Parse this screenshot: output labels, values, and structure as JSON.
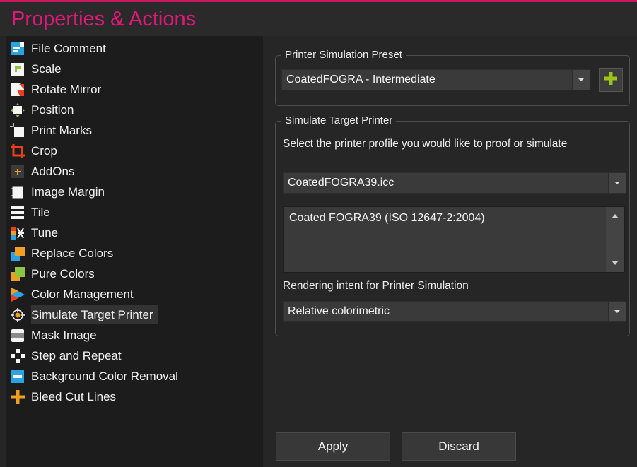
{
  "header": {
    "title": "Properties & Actions",
    "accent_color": "#e3177a"
  },
  "sidebar": {
    "items": [
      {
        "label": "File Comment",
        "icon": "file-comment-icon"
      },
      {
        "label": "Scale",
        "icon": "scale-icon"
      },
      {
        "label": "Rotate Mirror",
        "icon": "rotate-mirror-icon"
      },
      {
        "label": "Position",
        "icon": "position-icon"
      },
      {
        "label": "Print Marks",
        "icon": "print-marks-icon"
      },
      {
        "label": "Crop",
        "icon": "crop-icon"
      },
      {
        "label": "AddOns",
        "icon": "addons-icon"
      },
      {
        "label": "Image Margin",
        "icon": "image-margin-icon"
      },
      {
        "label": "Tile",
        "icon": "tile-icon"
      },
      {
        "label": "Tune",
        "icon": "tune-icon"
      },
      {
        "label": "Replace Colors",
        "icon": "replace-colors-icon"
      },
      {
        "label": "Pure Colors",
        "icon": "pure-colors-icon"
      },
      {
        "label": "Color Management",
        "icon": "color-management-icon"
      },
      {
        "label": "Simulate Target Printer",
        "icon": "simulate-target-printer-icon",
        "selected": true
      },
      {
        "label": "Mask Image",
        "icon": "mask-image-icon"
      },
      {
        "label": "Step and Repeat",
        "icon": "step-and-repeat-icon"
      },
      {
        "label": "Background Color Removal",
        "icon": "background-color-removal-icon"
      },
      {
        "label": "Bleed Cut Lines",
        "icon": "bleed-cut-lines-icon"
      }
    ]
  },
  "preset_group": {
    "legend": "Printer Simulation Preset",
    "selected": "CoatedFOGRA - Intermediate",
    "add_icon": "plus-icon"
  },
  "simulate_group": {
    "legend": "Simulate Target Printer",
    "instruction": "Select the printer profile you would like to proof or simulate",
    "profile_selected": "CoatedFOGRA39.icc",
    "profile_description": "Coated FOGRA39 (ISO 12647-2:2004)",
    "intent_label": "Rendering intent for Printer Simulation",
    "intent_selected": "Relative colorimetric"
  },
  "actions": {
    "apply_label": "Apply",
    "discard_label": "Discard"
  }
}
